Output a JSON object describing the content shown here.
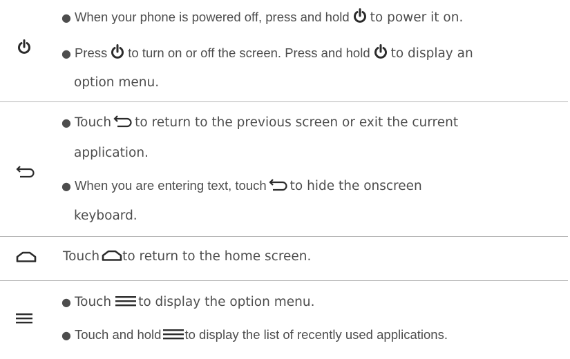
{
  "colors": {
    "text": "#4d4d4d",
    "icon": "#2b2b2b",
    "divider": "#b3b3b3"
  },
  "icons": {
    "power": "power-icon",
    "back": "back-arrow-icon",
    "home": "home-icon",
    "menu": "menu-icon"
  },
  "power_row": {
    "b1": {
      "seg1": "When your phone is powered off, press and hold",
      "seg2": "to power it on."
    },
    "b2": {
      "seg1": "Press",
      "seg2": "to turn on or off the screen. Press and hold",
      "seg3": "to display an",
      "cont": "option menu."
    }
  },
  "back_row": {
    "b1": {
      "seg1": "Touch",
      "seg2": "to return to the previous screen or exit the current",
      "cont": "application."
    },
    "b2": {
      "seg1": "When you are entering text, touch",
      "seg2": "to hide the onscreen",
      "cont": "keyboard."
    }
  },
  "home_row": {
    "seg1": "Touch",
    "seg2": "to return to the home screen."
  },
  "menu_row": {
    "b1": {
      "seg1": "Touch",
      "seg2": "to display the option menu."
    },
    "b2": {
      "seg1": "Touch and hold",
      "seg2": "to display the list of recently used applications."
    }
  }
}
